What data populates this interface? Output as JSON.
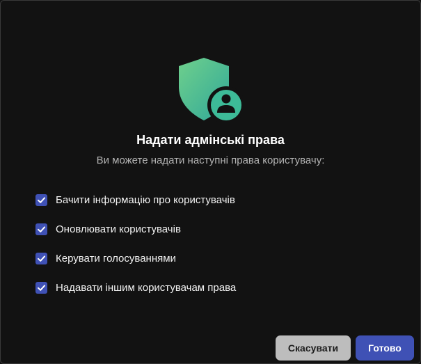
{
  "dialog": {
    "icon": "shield-user-icon",
    "title": "Надати адмінські права",
    "subtitle": "Ви можете надати наступні права користувачу:",
    "permissions": [
      {
        "label": "Бачити інформацію про користувачів",
        "checked": true
      },
      {
        "label": "Оновлювати користувачів",
        "checked": true
      },
      {
        "label": "Керувати голосуваннями",
        "checked": true
      },
      {
        "label": "Надавати іншим користувачам права",
        "checked": true
      }
    ],
    "buttons": {
      "cancel_label": "Скасувати",
      "done_label": "Готово"
    }
  },
  "colors": {
    "background": "#121212",
    "accent": "#3f51b5",
    "shield_gradient_start": "#6fd08c",
    "shield_gradient_end": "#36b3a0",
    "cancel_button": "#bdbdbd"
  }
}
